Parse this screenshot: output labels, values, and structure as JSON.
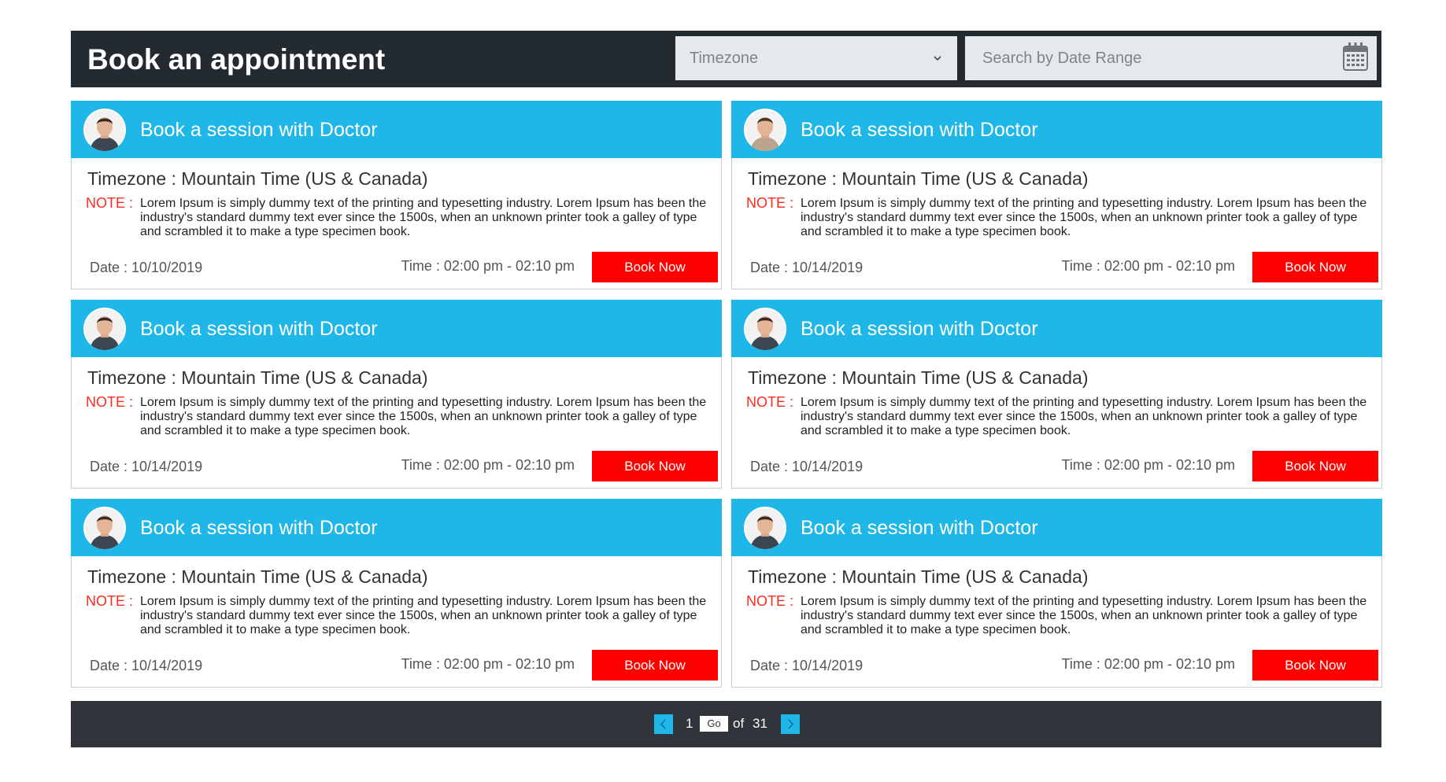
{
  "header": {
    "title": "Book an appointment",
    "timezone_placeholder": "Timezone",
    "date_search_placeholder": "Search by Date Range"
  },
  "cards": [
    {
      "title": "Book a session with Doctor",
      "timezone": "Timezone : Mountain Time (US & Canada)",
      "note_label": "NOTE :",
      "note": "Lorem Ipsum is simply dummy text of the printing and typesetting industry. Lorem Ipsum has been the industry's standard dummy text ever since the 1500s, when an unknown printer took a galley of type and scrambled it to make a type specimen book.",
      "date": "Date : 10/10/2019",
      "time": "Time : 02:00 pm - 02:10 pm",
      "button": "Book Now"
    },
    {
      "title": "Book a session with Doctor",
      "timezone": "Timezone : Mountain Time (US & Canada)",
      "note_label": "NOTE :",
      "note": "Lorem Ipsum is simply dummy text of the printing and typesetting industry. Lorem Ipsum has been the industry's standard dummy text ever since the 1500s, when an unknown printer took a galley of type and scrambled it to make a type specimen book.",
      "date": "Date : 10/14/2019",
      "time": "Time : 02:00 pm - 02:10 pm",
      "button": "Book Now"
    },
    {
      "title": "Book a session with Doctor",
      "timezone": "Timezone : Mountain Time (US & Canada)",
      "note_label": "NOTE :",
      "note": "Lorem Ipsum is simply dummy text of the printing and typesetting industry. Lorem Ipsum has been the industry's standard dummy text ever since the 1500s, when an unknown printer took a galley of type and scrambled it to make a type specimen book.",
      "date": "Date : 10/14/2019",
      "time": "Time : 02:00 pm - 02:10 pm",
      "button": "Book Now"
    },
    {
      "title": "Book a session with Doctor",
      "timezone": "Timezone : Mountain Time (US & Canada)",
      "note_label": "NOTE :",
      "note": "Lorem Ipsum is simply dummy text of the printing and typesetting industry. Lorem Ipsum has been the industry's standard dummy text ever since the 1500s, when an unknown printer took a galley of type and scrambled it to make a type specimen book.",
      "date": "Date : 10/14/2019",
      "time": "Time : 02:00 pm - 02:10 pm",
      "button": "Book Now"
    },
    {
      "title": "Book a session with Doctor",
      "timezone": "Timezone : Mountain Time (US & Canada)",
      "note_label": "NOTE :",
      "note": "Lorem Ipsum is simply dummy text of the printing and typesetting industry. Lorem Ipsum has been the industry's standard dummy text ever since the 1500s, when an unknown printer took a galley of type and scrambled it to make a type specimen book.",
      "date": "Date : 10/14/2019",
      "time": "Time : 02:00 pm - 02:10 pm",
      "button": "Book Now"
    },
    {
      "title": "Book a session with Doctor",
      "timezone": "Timezone : Mountain Time (US & Canada)",
      "note_label": "NOTE :",
      "note": "Lorem Ipsum is simply dummy text of the printing and typesetting industry. Lorem Ipsum has been the industry's standard dummy text ever since the 1500s, when an unknown printer took a galley of type and scrambled it to make a type specimen book.",
      "date": "Date : 10/14/2019",
      "time": "Time : 02:00 pm - 02:10 pm",
      "button": "Book Now"
    }
  ],
  "pagination": {
    "current_page": "1",
    "go_label": "Go",
    "of_label": "of",
    "total_pages": "31"
  },
  "colors": {
    "header_bg": "#232b30",
    "card_header": "#1fb7e8",
    "book_button": "#ff0000",
    "note_label": "#ff2a1f",
    "pager_bg": "#30353b"
  },
  "icons": [
    "chevron-down-icon",
    "calendar-icon",
    "doctor-avatar",
    "chevron-left-icon",
    "chevron-right-icon"
  ]
}
